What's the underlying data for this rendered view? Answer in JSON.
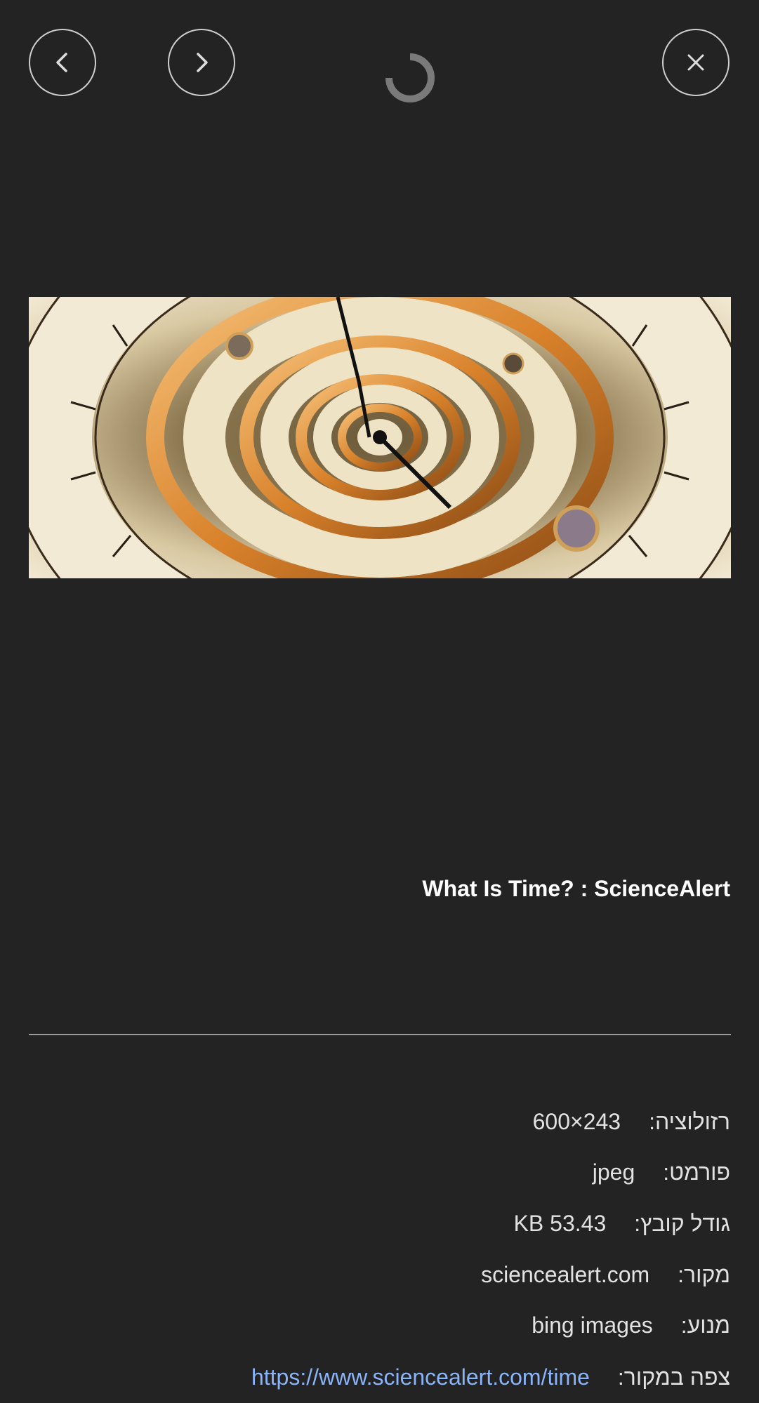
{
  "controls": {
    "prev_icon": "chevron-left-icon",
    "next_icon": "chevron-right-icon",
    "close_icon": "close-icon",
    "loading_icon": "spinner-icon"
  },
  "image": {
    "subject": "spiral clock face with Roman numerals and gears"
  },
  "caption": "What Is Time? : ScienceAlert",
  "details": {
    "resolution": {
      "label": "רזולוציה:",
      "value": "243×600"
    },
    "format": {
      "label": "פורמט:",
      "value": "jpeg"
    },
    "file_size": {
      "label": "גודל קובץ:",
      "value": "KB 53.43"
    },
    "source": {
      "label": "מקור:",
      "value": "sciencealert.com"
    },
    "engine": {
      "label": "מנוע:",
      "value": "bing images"
    },
    "view_source": {
      "label": "צפה במקור:",
      "value": "https://www.sciencealert.com/time"
    }
  },
  "colors": {
    "background": "#232323",
    "text": "#e2e2e2",
    "link": "#8ab4f8",
    "divider": "#9a9a9a"
  }
}
